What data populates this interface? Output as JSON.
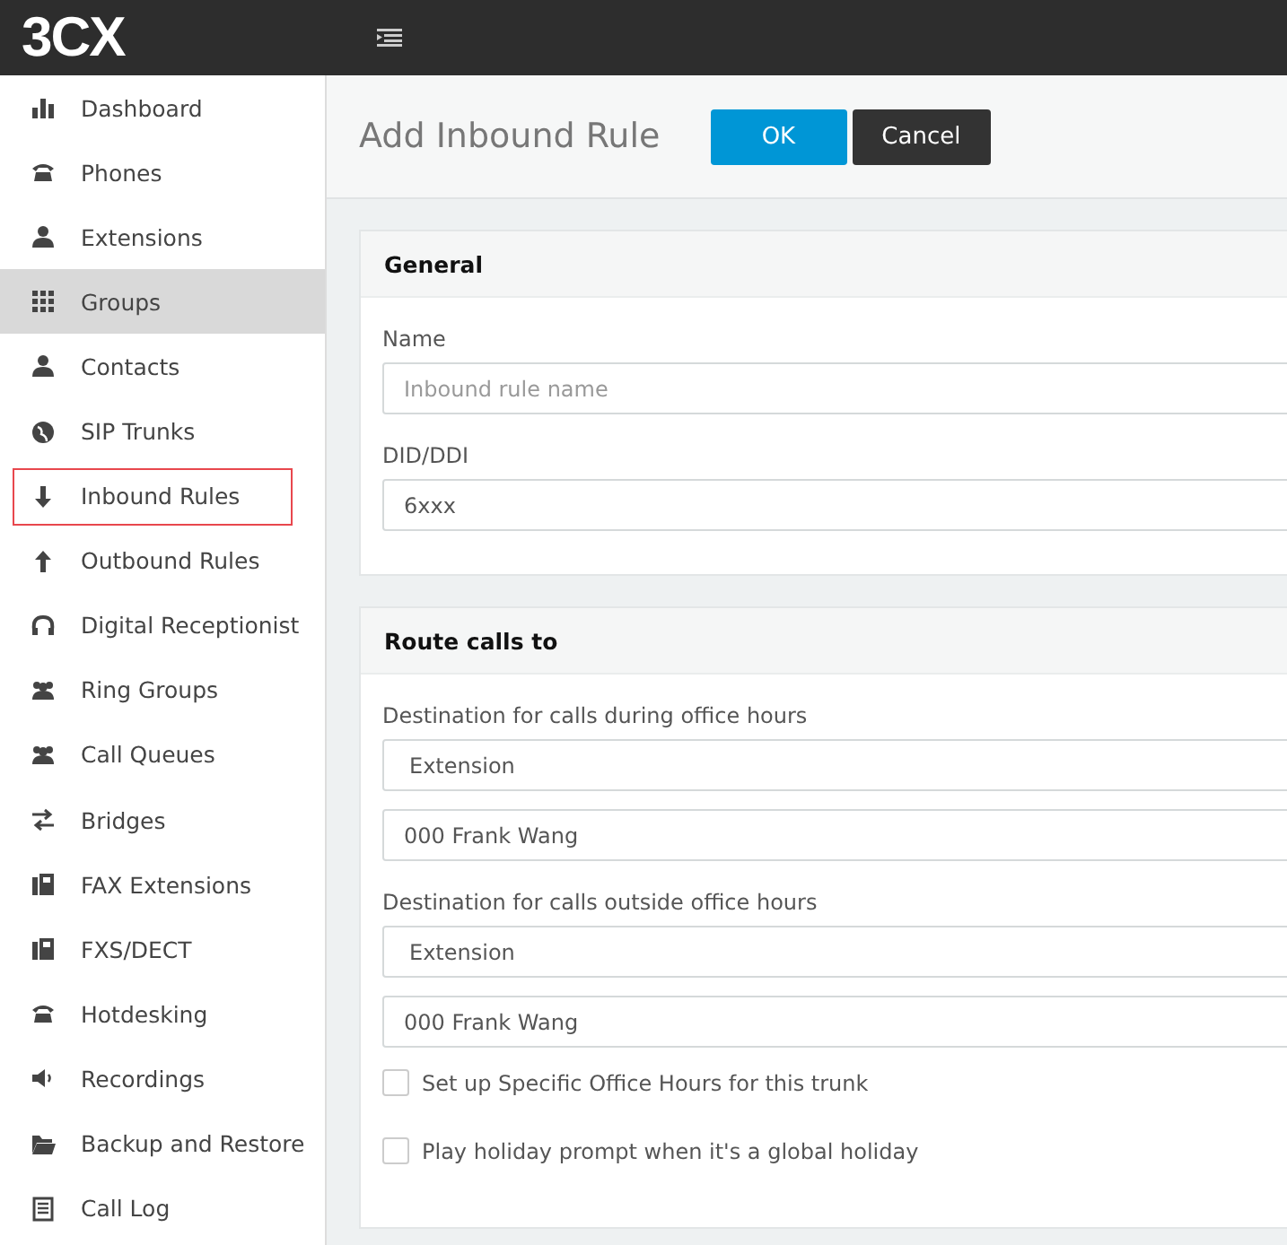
{
  "logo": "3CX",
  "sidebar": {
    "items": [
      {
        "label": "Dashboard",
        "selected": false,
        "outlined": false
      },
      {
        "label": "Phones",
        "selected": false,
        "outlined": false
      },
      {
        "label": "Extensions",
        "selected": false,
        "outlined": false
      },
      {
        "label": "Groups",
        "selected": true,
        "outlined": false
      },
      {
        "label": "Contacts",
        "selected": false,
        "outlined": false
      },
      {
        "label": "SIP Trunks",
        "selected": false,
        "outlined": false
      },
      {
        "label": "Inbound Rules",
        "selected": false,
        "outlined": true
      },
      {
        "label": "Outbound Rules",
        "selected": false,
        "outlined": false
      },
      {
        "label": "Digital Receptionist",
        "selected": false,
        "outlined": false
      },
      {
        "label": "Ring Groups",
        "selected": false,
        "outlined": false
      },
      {
        "label": "Call Queues",
        "selected": false,
        "outlined": false
      },
      {
        "label": "Bridges",
        "selected": false,
        "outlined": false
      },
      {
        "label": "FAX Extensions",
        "selected": false,
        "outlined": false
      },
      {
        "label": "FXS/DECT",
        "selected": false,
        "outlined": false
      },
      {
        "label": "Hotdesking",
        "selected": false,
        "outlined": false
      },
      {
        "label": "Recordings",
        "selected": false,
        "outlined": false
      },
      {
        "label": "Backup and Restore",
        "selected": false,
        "outlined": false
      },
      {
        "label": "Call Log",
        "selected": false,
        "outlined": false
      }
    ]
  },
  "page": {
    "title": "Add Inbound Rule",
    "buttons": [
      {
        "label": "OK",
        "kind": "primary"
      },
      {
        "label": "Cancel",
        "kind": "secondary"
      }
    ]
  },
  "sections": [
    {
      "title": "General",
      "rows": [
        {
          "kind": "label",
          "text": "Name"
        },
        {
          "kind": "input",
          "placeholder": "Inbound rule name"
        },
        {
          "kind": "label",
          "text": "DID/DDI"
        },
        {
          "kind": "input",
          "value": "6xxx"
        }
      ]
    },
    {
      "title": "Route calls to",
      "rows": [
        {
          "kind": "label",
          "text": "Destination for calls during office hours"
        },
        {
          "kind": "select",
          "value": "Extension"
        },
        {
          "kind": "input",
          "value": "000 Frank Wang"
        },
        {
          "kind": "label",
          "text": "Destination for calls outside office hours"
        },
        {
          "kind": "select",
          "value": "Extension"
        },
        {
          "kind": "input",
          "value": "000 Frank Wang"
        },
        {
          "kind": "checkbox",
          "text": "Set up Specific Office Hours for this trunk",
          "checked": false
        },
        {
          "kind": "checkbox",
          "text": "Play holiday prompt when it's a global holiday",
          "checked": false
        }
      ]
    }
  ]
}
